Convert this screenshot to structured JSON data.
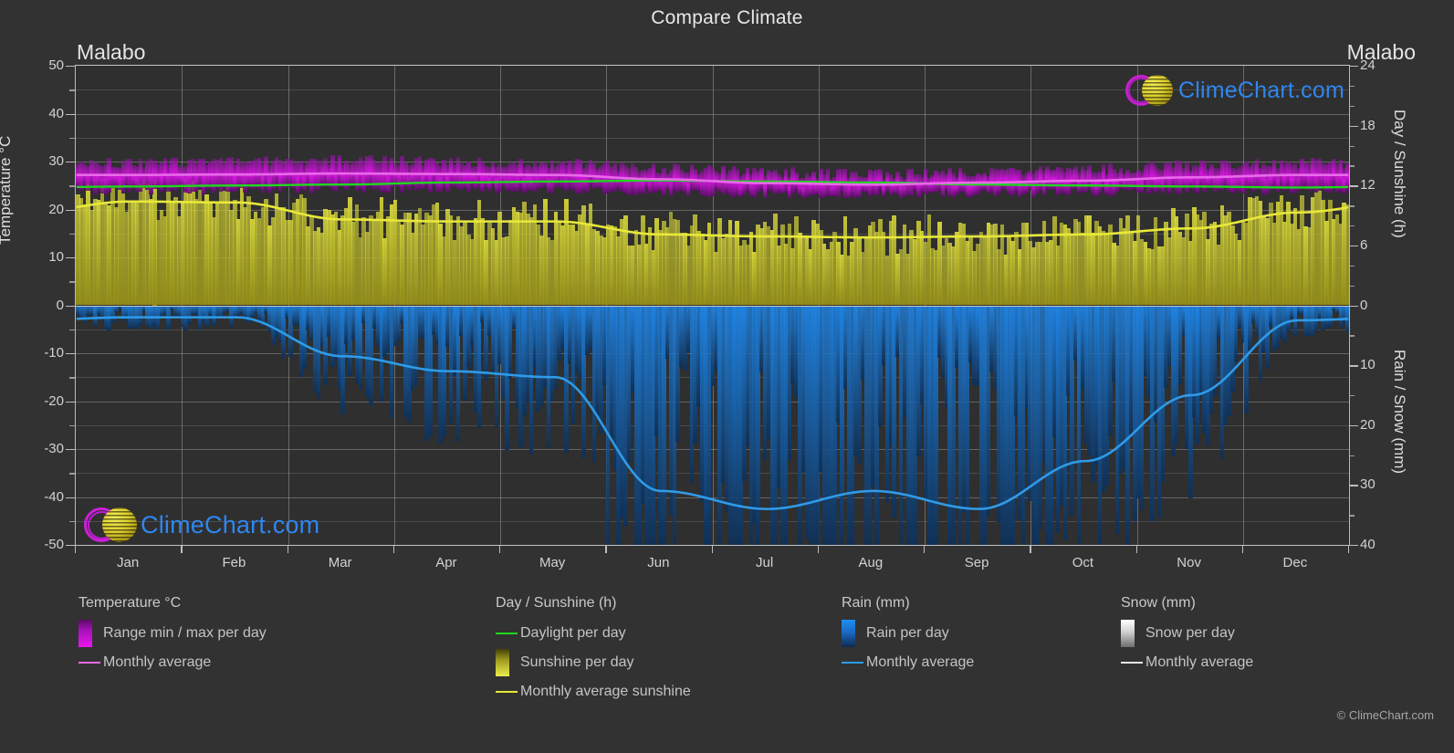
{
  "header": {
    "chart_title": "Compare Climate",
    "left_location": "Malabo",
    "right_location": "Malabo"
  },
  "branding": {
    "logo_text": "ClimeChart.com",
    "copyright": "© ClimeChart.com",
    "logo_ring_color": "#d01fd8",
    "logo_text_color": "#2f86ef",
    "logo_ball_color": "#dbd02e"
  },
  "axes": {
    "left": {
      "title": "Temperature °C",
      "ticks": [
        "50",
        "40",
        "30",
        "20",
        "10",
        "0",
        "-10",
        "-20",
        "-30",
        "-40",
        "-50"
      ],
      "min": -50,
      "max": 50
    },
    "right_top": {
      "title": "Day / Sunshine (h)",
      "ticks": [
        "24",
        "18",
        "12",
        "6",
        "0"
      ],
      "min": 0,
      "max": 24
    },
    "right_bottom": {
      "title": "Rain / Snow (mm)",
      "ticks": [
        "0",
        "10",
        "20",
        "30",
        "40"
      ],
      "min": 0,
      "max": 40
    },
    "x": {
      "ticks": [
        "Jan",
        "Feb",
        "Mar",
        "Apr",
        "May",
        "Jun",
        "Jul",
        "Aug",
        "Sep",
        "Oct",
        "Nov",
        "Dec"
      ]
    }
  },
  "legend": {
    "columns": [
      {
        "heading": "Temperature °C",
        "items": [
          {
            "label": "Range min / max per day",
            "style": "swatch",
            "color": "#e010e8"
          },
          {
            "label": "Monthly average",
            "style": "line",
            "color": "#e86ae8"
          }
        ]
      },
      {
        "heading": "Day / Sunshine (h)",
        "items": [
          {
            "label": "Daylight per day",
            "style": "line",
            "color": "#1ed81e"
          },
          {
            "label": "Sunshine per day",
            "style": "swatch",
            "color": "#e8e840"
          },
          {
            "label": "Monthly average sunshine",
            "style": "line",
            "color": "#e8e83a"
          }
        ]
      },
      {
        "heading": "Rain (mm)",
        "items": [
          {
            "label": "Rain per day",
            "style": "swatch",
            "color": "#1f7fe0"
          },
          {
            "label": "Monthly average",
            "style": "line",
            "color": "#2f9be8"
          }
        ]
      },
      {
        "heading": "Snow (mm)",
        "items": [
          {
            "label": "Snow per day",
            "style": "swatch",
            "color": "#efefef"
          },
          {
            "label": "Monthly average",
            "style": "line",
            "color": "#e6e6e6"
          }
        ]
      }
    ]
  },
  "chart_data": {
    "type": "area",
    "title": "Compare Climate",
    "subtitle": "Malabo",
    "xlabel": "",
    "ylabel": "Temperature °C",
    "categories": [
      "Jan",
      "Feb",
      "Mar",
      "Apr",
      "May",
      "Jun",
      "Jul",
      "Aug",
      "Sep",
      "Oct",
      "Nov",
      "Dec"
    ],
    "ylim": [
      -50,
      50
    ],
    "y2_top_lim": [
      0,
      24
    ],
    "y2_bottom_lim": [
      0,
      40
    ],
    "grid": true,
    "legend_position": "bottom",
    "series": [
      {
        "name": "Monthly average temperature",
        "unit": "°C",
        "color": "#e86ae8",
        "axis": "left",
        "values": [
          27.2,
          27.3,
          27.5,
          27.4,
          27.2,
          26.3,
          25.5,
          25.2,
          25.6,
          26.0,
          26.7,
          27.2
        ]
      },
      {
        "name": "Range max per day",
        "unit": "°C",
        "color": "#e010e8",
        "axis": "left",
        "values": [
          29.5,
          29.8,
          30.0,
          29.8,
          29.4,
          28.4,
          27.5,
          27.2,
          27.6,
          28.2,
          28.9,
          29.4
        ]
      },
      {
        "name": "Range min per day",
        "unit": "°C",
        "color": "#8a0f96",
        "axis": "left",
        "values": [
          24.0,
          24.2,
          24.4,
          24.3,
          24.2,
          23.7,
          23.3,
          23.2,
          23.4,
          23.7,
          24.0,
          24.1
        ]
      },
      {
        "name": "Daylight per day",
        "unit": "h",
        "color": "#1ed81e",
        "axis": "right_top",
        "values": [
          11.9,
          12.0,
          12.1,
          12.3,
          12.4,
          12.5,
          12.4,
          12.3,
          12.1,
          12.0,
          11.9,
          11.8
        ]
      },
      {
        "name": "Monthly average sunshine",
        "unit": "h",
        "color": "#e8e83a",
        "axis": "right_top",
        "values": [
          10.4,
          10.3,
          8.6,
          8.4,
          8.4,
          7.1,
          6.9,
          6.8,
          6.9,
          7.1,
          7.7,
          9.3
        ]
      },
      {
        "name": "Rain monthly average",
        "unit": "mm",
        "color": "#2f9be8",
        "axis": "right_bottom",
        "values": [
          2.0,
          2.0,
          8.5,
          11.0,
          12.0,
          31.0,
          34.0,
          31.0,
          34.0,
          26.0,
          15.0,
          2.5
        ]
      },
      {
        "name": "Snow monthly average",
        "unit": "mm",
        "color": "#e6e6e6",
        "axis": "right_bottom",
        "values": [
          0,
          0,
          0,
          0,
          0,
          0,
          0,
          0,
          0,
          0,
          0,
          0
        ]
      }
    ]
  }
}
